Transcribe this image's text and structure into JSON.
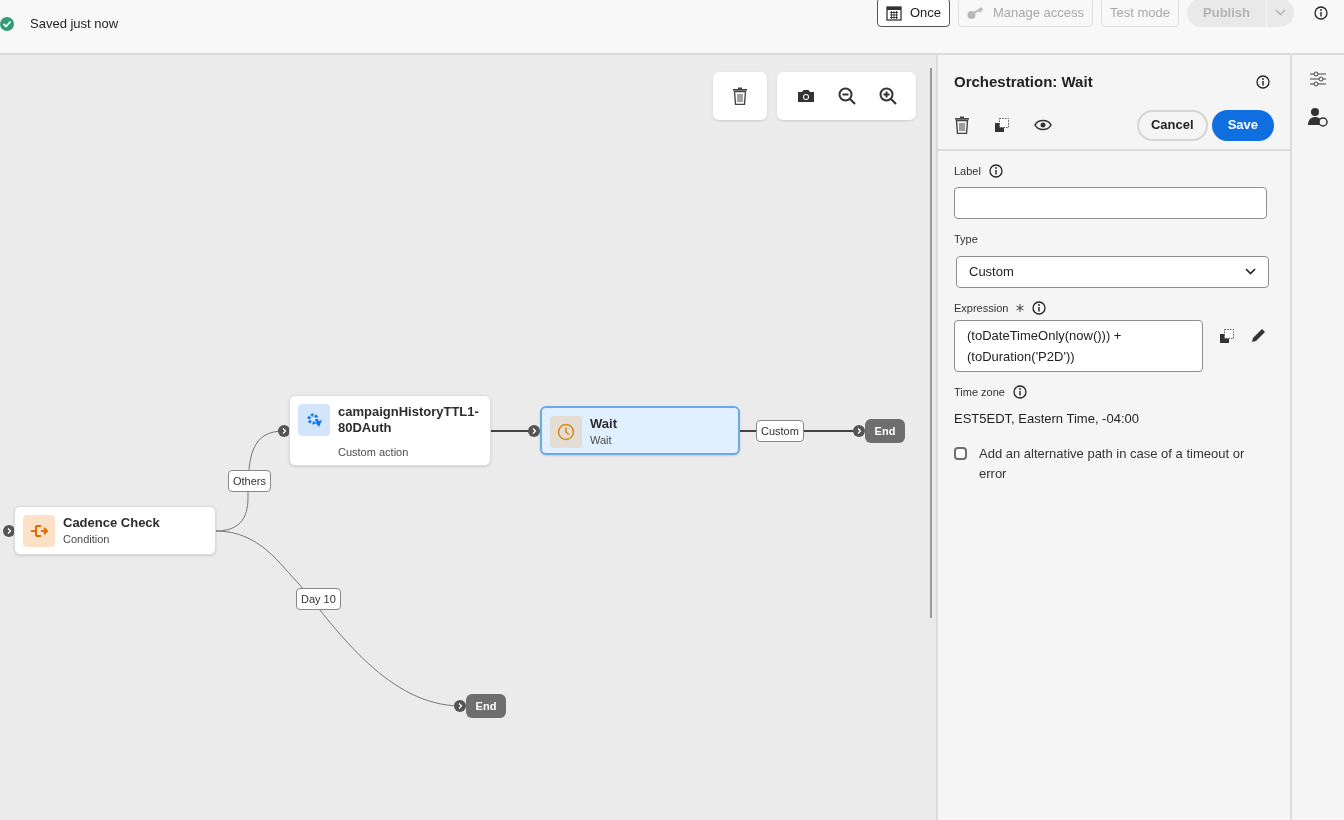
{
  "header": {
    "status": "Saved just now",
    "saved": true,
    "buttons": [
      {
        "kind": "schedule",
        "label": "Once",
        "disabled": false
      },
      {
        "kind": "access",
        "label": "Manage access",
        "disabled": true
      },
      {
        "kind": "plain",
        "label": "Test mode",
        "disabled": true
      },
      {
        "kind": "publish",
        "label": "Publish",
        "disabled": true
      }
    ]
  },
  "canvas": {
    "nodes": [
      {
        "kind": "condition",
        "title": "Cadence Check",
        "subtitle": "Condition",
        "selected": false
      },
      {
        "kind": "action",
        "title": "campaignHistoryTTL1-80DAuth",
        "subtitle": "Custom action",
        "selected": false
      },
      {
        "kind": "wait",
        "title": "Wait",
        "subtitle": "Wait",
        "selected": true
      },
      {
        "kind": "end",
        "title": "End",
        "selected": false
      },
      {
        "kind": "end",
        "title": "End",
        "selected": false
      }
    ],
    "edge_labels": [
      "Others",
      "Custom",
      "Day 10"
    ]
  },
  "panel": {
    "title": "Orchestration: Wait",
    "cancel": "Cancel",
    "save": "Save",
    "label_field": {
      "label": "Label"
    },
    "type_field": {
      "label": "Type",
      "value": "Custom"
    },
    "expression": {
      "label": "Expression",
      "required": true,
      "value": "(toDateTimeOnly(now())) + (toDuration('P2D'))"
    },
    "timezone": {
      "label": "Time zone",
      "value": "EST5EDT, Eastern Time, -04:00"
    },
    "alt_path": {
      "label": "Add an alternative path in case of a timeout or error",
      "checked": false
    }
  }
}
